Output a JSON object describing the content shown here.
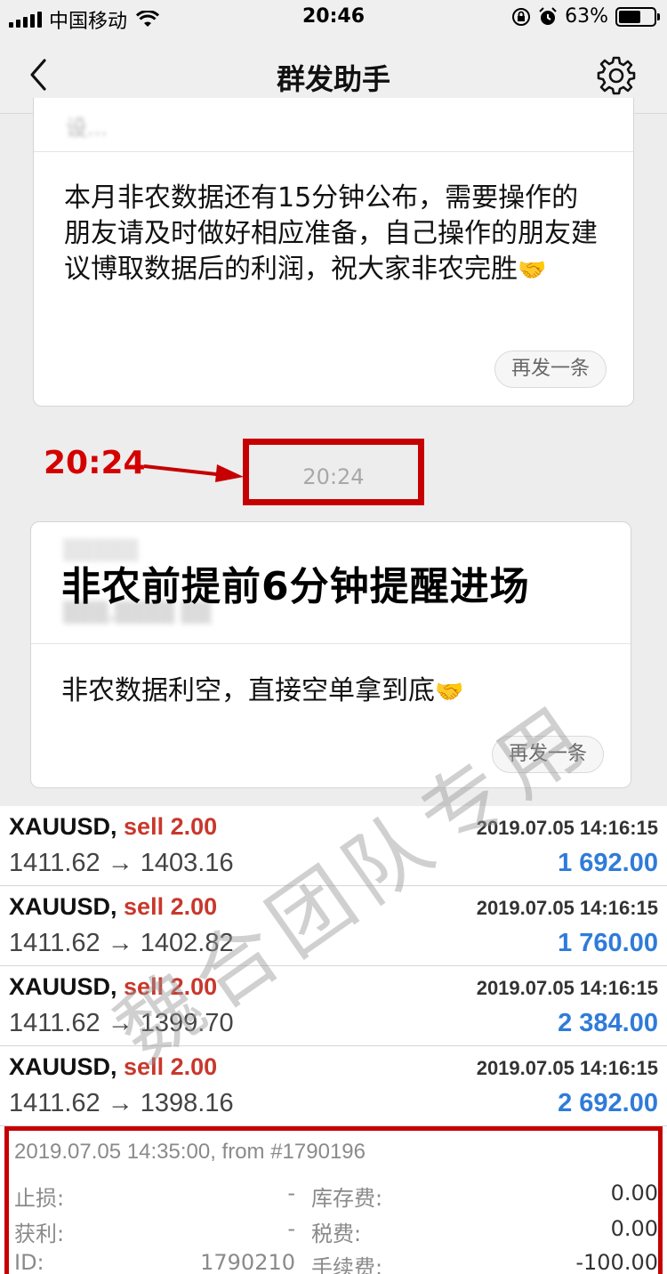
{
  "status_bar": {
    "carrier": "中国移动",
    "time": "20:46",
    "battery": "63%",
    "battery_level": 0.63
  },
  "nav": {
    "title": "群发助手"
  },
  "card1": {
    "blurred_header": "设...",
    "message": "本月非农数据还有15分钟公布，需要操作的朋友请及时做好相应准备，自己操作的朋友建议博取数据后的利润，祝大家非农完胜",
    "emoji": "🤝",
    "resend": "再发一条"
  },
  "timestamp": {
    "label": "20:24",
    "annotation": "20:24"
  },
  "card2": {
    "headline": "非农前提前6分钟提醒进场",
    "message": "非农数据利空，直接空单拿到底",
    "emoji": "🤝",
    "resend": "再发一条"
  },
  "trades": [
    {
      "symbol": "XAUUSD,",
      "side": "sell 2.00",
      "date": "2019.07.05 14:16:15",
      "price": "1411.62 → 1403.16",
      "profit": "1 692.00"
    },
    {
      "symbol": "XAUUSD,",
      "side": "sell 2.00",
      "date": "2019.07.05 14:16:15",
      "price": "1411.62 → 1402.82",
      "profit": "1 760.00"
    },
    {
      "symbol": "XAUUSD,",
      "side": "sell 2.00",
      "date": "2019.07.05 14:16:15",
      "price": "1411.62 → 1399.70",
      "profit": "2 384.00"
    },
    {
      "symbol": "XAUUSD,",
      "side": "sell 2.00",
      "date": "2019.07.05 14:16:15",
      "price": "1411.62 → 1398.16",
      "profit": "2 692.00"
    }
  ],
  "detail": {
    "header": "2019.07.05 14:35:00, from #1790196",
    "rows": [
      {
        "label1": "止损:",
        "value1": "-",
        "label2": "库存费:",
        "value2": "0.00"
      },
      {
        "label1": "获利:",
        "value1": "-",
        "label2": "税费:",
        "value2": "0.00"
      },
      {
        "label1": "ID:",
        "value1": "1790210",
        "label2": "手续费:",
        "value2": "-100.00"
      }
    ]
  },
  "watermark": "魏合团队专用",
  "colors": {
    "accent_red": "#c60000",
    "sell_red": "#c8382c",
    "profit_blue": "#2f7bd9"
  }
}
